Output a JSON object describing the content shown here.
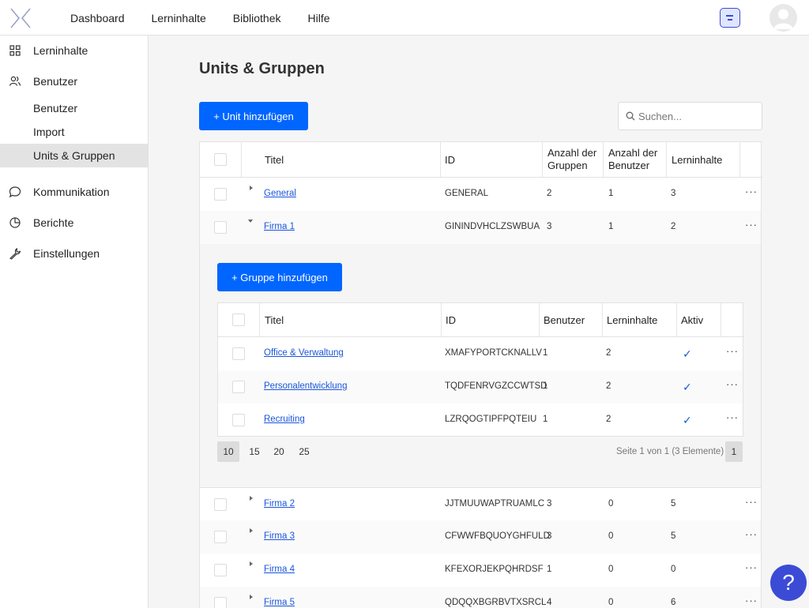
{
  "topnav": {
    "items": [
      "Dashboard",
      "Lerninhalte",
      "Bibliothek",
      "Hilfe"
    ]
  },
  "sidebar": {
    "lerninhalte": "Lerninhalte",
    "benutzer": "Benutzer",
    "sub": [
      "Benutzer",
      "Import",
      "Units & Gruppen"
    ],
    "kommunikation": "Kommunikation",
    "berichte": "Berichte",
    "einstellungen": "Einstellungen"
  },
  "main": {
    "title": "Units & Gruppen",
    "add_unit_label": "+ Unit hinzufügen",
    "search_placeholder": "Suchen..."
  },
  "table": {
    "headers": {
      "titel": "Titel",
      "id": "ID",
      "gruppen_1": "Anzahl der",
      "gruppen_2": "Gruppen",
      "benutzer_1": "Anzahl der",
      "benutzer_2": "Benutzer",
      "lerninhalte": "Lerninhalte"
    },
    "rows": [
      {
        "title": "General",
        "id": "GENERAL",
        "groups": "2",
        "users": "1",
        "content": "3"
      },
      {
        "title": "Firma 1",
        "id": "GININDVHCLZSWBUA",
        "groups": "3",
        "users": "1",
        "content": "2"
      },
      {
        "title": "Firma 2",
        "id": "JJTMUUWAPTRUAMLC",
        "groups": "3",
        "users": "0",
        "content": "5"
      },
      {
        "title": "Firma 3",
        "id": "CFWWFBQUOYGHFULD",
        "groups": "3",
        "users": "0",
        "content": "5"
      },
      {
        "title": "Firma 4",
        "id": "KFEXORJEKPQHRDSF",
        "groups": "1",
        "users": "0",
        "content": "0"
      },
      {
        "title": "Firma 5",
        "id": "QDQQXBGRBVTXSRCL",
        "groups": "4",
        "users": "0",
        "content": "6"
      }
    ],
    "more_label": "···"
  },
  "groups": {
    "add_group_label": "+ Gruppe hinzufügen",
    "headers": {
      "titel": "Titel",
      "id": "ID",
      "benutzer": "Benutzer",
      "lerninhalte": "Lerninhalte",
      "aktiv": "Aktiv"
    },
    "rows": [
      {
        "title": "Office & Verwaltung",
        "id": "XMAFYPORTCKNALLV",
        "users": "1",
        "content": "2",
        "active": "✓"
      },
      {
        "title": "Personalentwicklung",
        "id": "TQDFENRVGZCCWTSD",
        "users": "1",
        "content": "2",
        "active": "✓"
      },
      {
        "title": "Recruiting",
        "id": "LZRQOGTIPFPQTEIU",
        "users": "1",
        "content": "2",
        "active": "✓"
      }
    ],
    "page_sizes": [
      "10",
      "15",
      "20",
      "25"
    ],
    "page_info": "Seite 1 von 1 (3 Elemente)",
    "current_page": "1"
  },
  "help_label": "?",
  "colors": {
    "primary": "#0066ff",
    "accent": "#3b4bd6",
    "link": "#1a56db"
  }
}
